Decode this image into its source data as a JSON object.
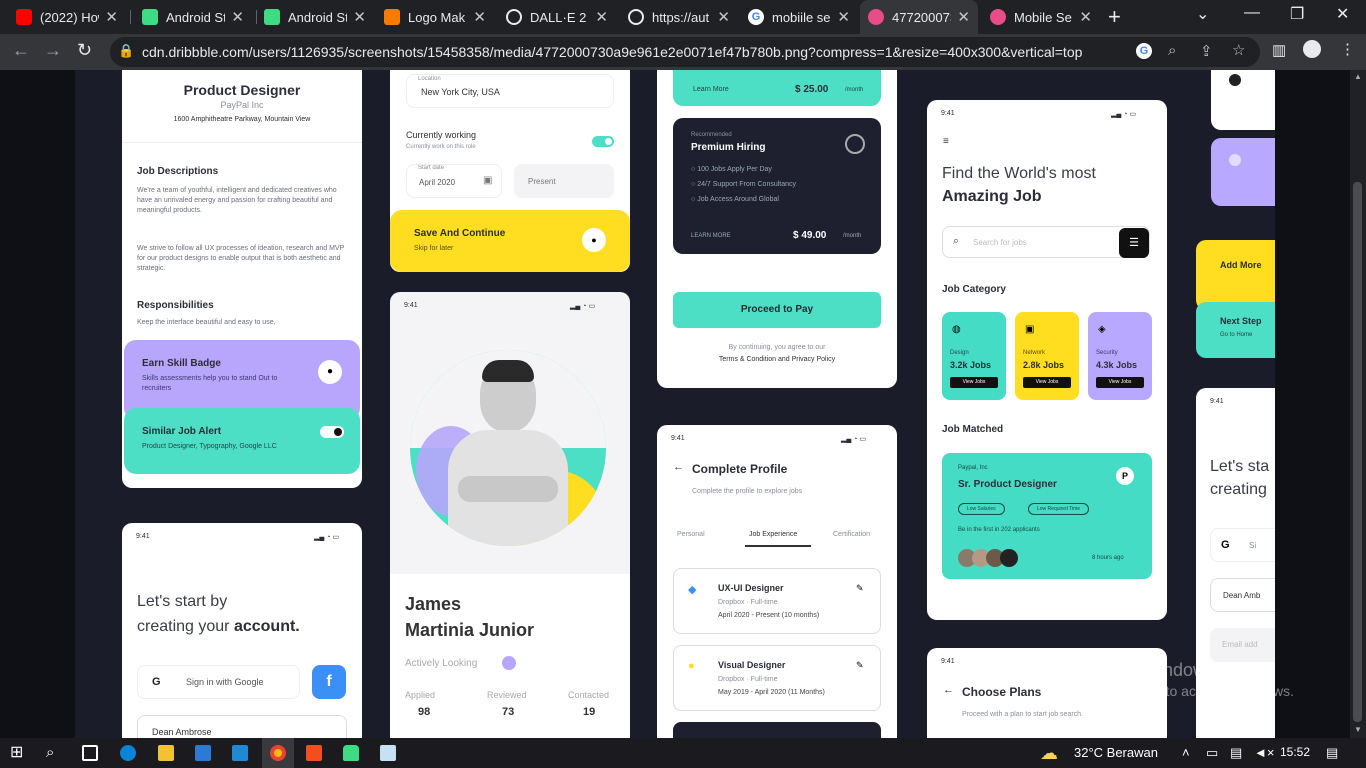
{
  "browser": {
    "tabs": [
      {
        "title": "(2022) How",
        "color": "#ff0000"
      },
      {
        "title": "Android St",
        "color": "#3ddc84"
      },
      {
        "title": "Android St",
        "color": "#3ddc84"
      },
      {
        "title": "Logo Mak",
        "color": "#f57c00"
      },
      {
        "title": "DALL·E 2",
        "color": "#e8eaed"
      },
      {
        "title": "https://aut",
        "color": "#e8eaed"
      },
      {
        "title": "mobiile se",
        "color": "#4285f4"
      },
      {
        "title": "477200073",
        "color": "#ea4c89"
      },
      {
        "title": "Mobile Se",
        "color": "#ea4c89"
      }
    ],
    "url": "cdn.dribbble.com/users/1126935/screenshots/15458358/media/4772000730a9e961e2e0071ef47b780b.png?compress=1&resize=400x300&vertical=top"
  },
  "shot": {
    "col1": {
      "title": "Product Designer",
      "company": "PayPal Inc",
      "address": "1600 Amphitheatre Parkway, Mountain View",
      "desc_head": "Job Descriptions",
      "desc1": "We're a team of youthful, intelligent and dedicated creatives who have an unrivaled energy and passion for crafting beautiful and meaningful products.",
      "desc2": "We strive to follow all UX processes of ideation, research and MVP for our product designs to enable output that is both aesthetic and strategic.",
      "resp_head": "Responsibilities",
      "resp": "Keep the interface beautiful and easy to use.",
      "badge_title": "Earn Skill Badge",
      "badge_sub": "Skills assessments help you to stand Out to recruiters",
      "alert_title": "Similar Job Alert",
      "alert_sub": "Product Designer, Typography, Google LLC",
      "time": "9:41",
      "start1": "Let's start by",
      "start2": "creating your",
      "start3": "account.",
      "google": "Sign in with Google",
      "name_field": "Dean Ambrose"
    },
    "col2": {
      "location_label": "Location",
      "location": "New York City, USA",
      "working": "Currently working",
      "working_sub": "Currently work on this role",
      "start_label": "Start date",
      "start_date": "April 2020",
      "present": "Present",
      "save": "Save And Continue",
      "skip": "Skip for later",
      "time": "9:41",
      "name1": "James",
      "name2": "Martinia Junior",
      "status": "Actively Looking",
      "stats": [
        {
          "label": "Applied",
          "value": "98"
        },
        {
          "label": "Reviewed",
          "value": "73"
        },
        {
          "label": "Contacted",
          "value": "19"
        }
      ]
    },
    "col3": {
      "learn": "Learn More",
      "price1": "$ 25.00",
      "per": "/month",
      "recommended": "Recommended",
      "premium": "Premium Hiring",
      "features": [
        "100 Jobs Apply Per Day",
        "24/7 Support From Consultancy",
        "Job Access Around Global"
      ],
      "learn2": "LEARN MORE",
      "price2": "$ 49.00",
      "proceed": "Proceed to Pay",
      "agree": "By continuing, you agree to our",
      "terms": "Terms & Condition and Privacy Policy",
      "time": "9:41",
      "profile": "Complete Profile",
      "profile_sub": "Complete the profile to explore jobs",
      "tabs": [
        "Personal",
        "Job Experience",
        "Certification"
      ],
      "jobs": [
        {
          "title": "UX-UI Designer",
          "company": "Dropbox · Full-time",
          "period": "April 2020 - Present (10 months)"
        },
        {
          "title": "Visual Designer",
          "company": "Dropbox · Full-time",
          "period": "May 2019 - April 2020 (11 Months)"
        }
      ]
    },
    "col4": {
      "time": "9:41",
      "find1": "Find the World's most",
      "find2": "Amazing Job",
      "search": "Search for jobs",
      "category": "Job Category",
      "cats": [
        {
          "name": "Design",
          "count": "3.2k Jobs",
          "color": "#44dcc4"
        },
        {
          "name": "Network",
          "count": "2.8k Jobs",
          "color": "#ffdd1f"
        },
        {
          "name": "Security",
          "count": "4.3k Jobs",
          "color": "#b9a8ff"
        }
      ],
      "view": "View Jobs",
      "matched": "Job Matched",
      "match_company": "Paypal, Inc",
      "match_title": "Sr. Product Designer",
      "tag1": "Low Salaries",
      "tag2": "Low Required Time",
      "first": "Be in the first in 202 applicants",
      "ago": "8 hours ago",
      "plans": "Choose Plans",
      "plans_sub": "Proceed with a plan to start job search."
    },
    "col5": {
      "add": "Add More",
      "next": "Next Step",
      "next_sub": "Go to Home",
      "lets1": "Let's sta",
      "lets2": "creating",
      "sign": "Si",
      "name": "Dean Amb",
      "email": "Email add"
    }
  },
  "watermark": {
    "line1": "Activate Windows",
    "line2": "Go to Settings to activate Windows."
  },
  "taskbar": {
    "weather": "32°C  Berawan",
    "time": "15:52"
  }
}
